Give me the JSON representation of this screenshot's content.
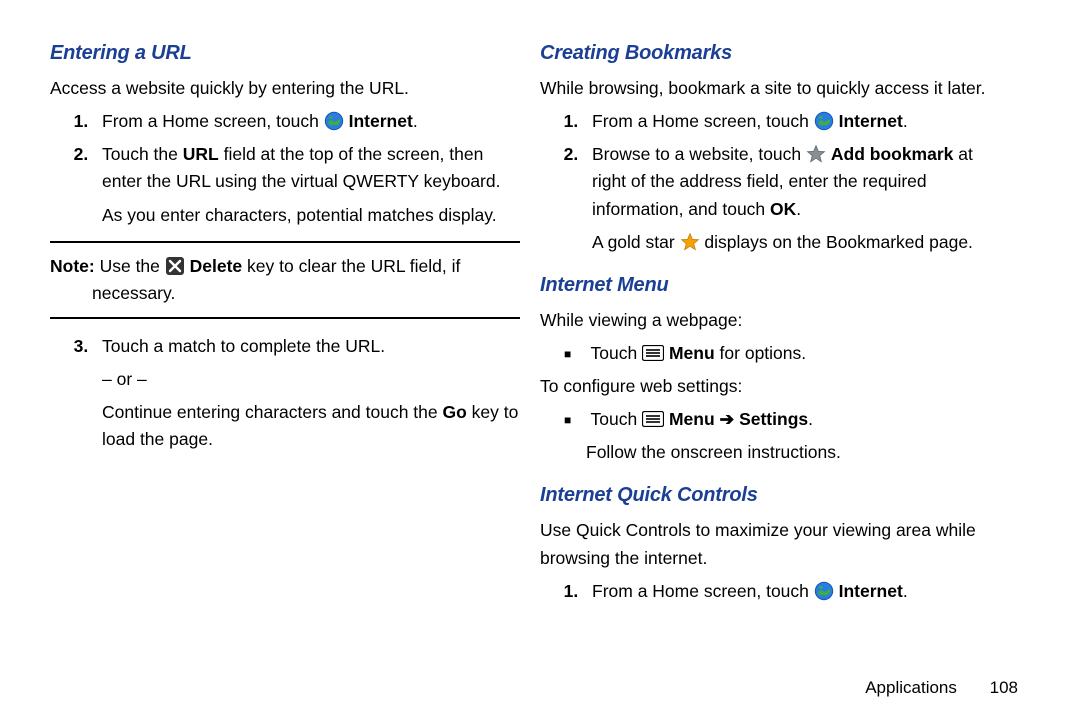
{
  "left": {
    "h1": "Entering a URL",
    "intro": "Access a website quickly by entering the URL.",
    "step1_a": "From a Home screen, touch ",
    "step1_b": "Internet",
    "step1_c": ".",
    "step2_a": "Touch the ",
    "step2_url": "URL",
    "step2_b": " field at the top of the screen, then enter the URL using the virtual QWERTY keyboard.",
    "step2_sub": "As you enter characters, potential matches display.",
    "note_lead": "Note:",
    "note_a": " Use the ",
    "note_del": "Delete",
    "note_b": " key to clear the URL field, if necessary.",
    "step3_a": "Touch a match to complete the URL.",
    "step3_or": "– or –",
    "step3_b_a": "Continue entering characters and touch the ",
    "step3_go": "Go",
    "step3_b_b": " key to load the page."
  },
  "right": {
    "h1": "Creating Bookmarks",
    "intro": "While browsing, bookmark a site to quickly access it later.",
    "cb_step1_a": "From a Home screen, touch ",
    "cb_step1_b": "Internet",
    "cb_step1_c": ".",
    "cb_step2_a": "Browse to a website, touch ",
    "cb_step2_add": "Add bookmark",
    "cb_step2_b": " at right of the address field, enter the required information, and touch ",
    "cb_step2_ok": "OK",
    "cb_step2_c": ".",
    "cb_step2_sub_a": "A gold star ",
    "cb_step2_sub_b": " displays on the Bookmarked page.",
    "h2": "Internet Menu",
    "im_intro": "While viewing a webpage:",
    "im_b1_a": "Touch ",
    "im_b1_menu": "Menu",
    "im_b1_b": " for options.",
    "im_cfg": "To configure web settings:",
    "im_b2_a": "Touch ",
    "im_b2_menu": "Menu",
    "im_b2_arrow": " ➔ ",
    "im_b2_set": "Settings",
    "im_b2_c": ".",
    "im_b2_sub": "Follow the onscreen instructions.",
    "h3": "Internet Quick Controls",
    "iqc_intro": "Use Quick Controls to maximize your viewing area while browsing the internet.",
    "iqc_step1_a": "From a Home screen, touch ",
    "iqc_step1_b": "Internet",
    "iqc_step1_c": "."
  },
  "footer": {
    "section": "Applications",
    "page": "108"
  }
}
